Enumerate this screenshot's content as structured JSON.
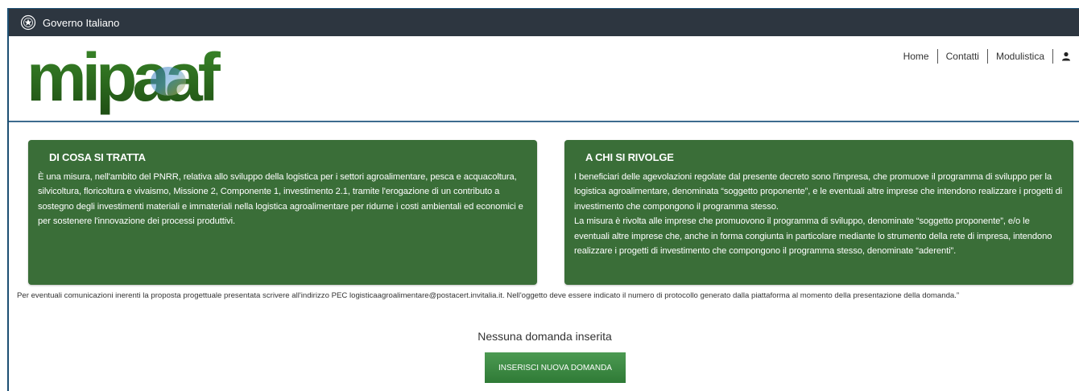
{
  "gov_bar": {
    "name": "Governo Italiano"
  },
  "logo": {
    "text": "mipaaf"
  },
  "nav": {
    "items": [
      "Home",
      "Contatti",
      "Modulistica"
    ]
  },
  "card_left": {
    "title": "DI COSA SI TRATTA",
    "text": "È una misura, nell'ambito del PNRR, relativa allo sviluppo della logistica per i settori agroalimentare, pesca e acquacoltura, silvicoltura, floricoltura e vivaismo, Missione 2, Componente 1, investimento 2.1, tramite l'erogazione di un contributo a sostegno degli investimenti materiali e immateriali nella logistica agroalimentare per ridurne i costi ambientali ed economici e per sostenere l'innovazione dei processi produttivi."
  },
  "card_right": {
    "title": "A CHI SI RIVOLGE",
    "text1": "I beneficiari delle agevolazioni regolate dal presente decreto sono l'impresa, che promuove il programma di sviluppo per la logistica agroalimentare, denominata “soggetto proponente”, e le eventuali altre imprese che intendono realizzare i progetti di investimento che compongono il programma stesso.",
    "text2": "La misura è rivolta alle imprese che promuovono il programma di sviluppo, denominate “soggetto proponente”, e/o le eventuali altre imprese che, anche in forma congiunta in particolare mediante lo strumento della rete di impresa, intendono realizzare i progetti di investimento che compongono il programma stesso, denominate “aderenti”."
  },
  "pec_note": "Per eventuali comunicazioni inerenti la proposta progettuale presentata scrivere all'indirizzo PEC logisticaagroalimentare@postacert.invitalia.it. Nell'oggetto deve essere indicato il numero di protocollo generato dalla piattaforma al momento della presentazione della domanda.”",
  "empty_state": "Nessuna domanda inserita",
  "add_button": "INSERISCI NUOVA DOMANDA",
  "colors": {
    "gov_bar": "#2d3640",
    "card_bg": "#3a6e38",
    "button": "#3d8a44",
    "accent_border": "#1d4f73"
  },
  "icons": {
    "gov_emblem": "italian-emblem-icon",
    "user": "user-icon"
  }
}
